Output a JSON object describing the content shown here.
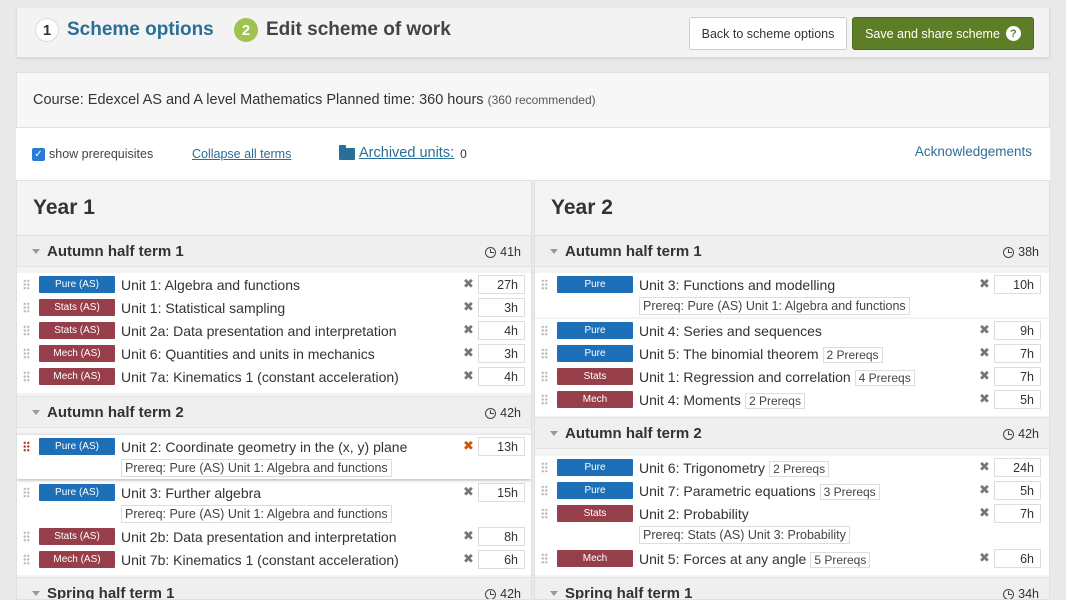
{
  "header": {
    "step1": {
      "num": "1",
      "label": "Scheme options"
    },
    "step2": {
      "num": "2",
      "label": "Edit scheme of work"
    },
    "back_label": "Back to scheme options",
    "save_label": "Save and share scheme",
    "help_glyph": "?"
  },
  "course": {
    "text": "Course: Edexcel AS and A level Mathematics Planned time: 360 hours",
    "recommended": "(360 recommended)"
  },
  "options": {
    "show_prereq": "show prerequisites",
    "collapse_all": "Collapse all terms",
    "archived_label": "Archived units:",
    "archived_count": "0",
    "acknowledgements": "Acknowledgements"
  },
  "colors": {
    "pure": "#1d6fb8",
    "stats": "#963f4a",
    "mech": "#963f4a",
    "save_green": "#5e7d27"
  },
  "years": [
    {
      "title": "Year 1",
      "terms": [
        {
          "name": "Autumn half term 1",
          "hours": "41h",
          "units": [
            {
              "badge": "Pure (AS)",
              "type": "pure",
              "title": "Unit 1: Algebra and functions",
              "hours": "27h"
            },
            {
              "badge": "Stats (AS)",
              "type": "stats",
              "title": "Unit 1: Statistical sampling",
              "hours": "3h"
            },
            {
              "badge": "Stats (AS)",
              "type": "stats",
              "title": "Unit 2a: Data presentation and interpretation",
              "hours": "4h"
            },
            {
              "badge": "Mech (AS)",
              "type": "mech",
              "title": "Unit 6: Quantities and units in mechanics",
              "hours": "3h"
            },
            {
              "badge": "Mech (AS)",
              "type": "mech",
              "title": "Unit 7a: Kinematics 1 (constant acceleration)",
              "hours": "4h"
            }
          ]
        },
        {
          "name": "Autumn half term 2",
          "hours": "42h",
          "units": [
            {
              "badge": "Pure (AS)",
              "type": "pure",
              "title": "Unit 2: Coordinate geometry in the (x, y) plane",
              "prereq": "Prereq: Pure (AS) Unit 1: Algebra and functions",
              "hours": "13h"
            },
            {
              "badge": "Pure (AS)",
              "type": "pure",
              "title": "Unit 3: Further algebra",
              "prereq": "Prereq: Pure (AS) Unit 1: Algebra and functions",
              "hours": "15h"
            },
            {
              "badge": "Stats (AS)",
              "type": "stats",
              "title": "Unit 2b: Data presentation and interpretation",
              "hours": "8h"
            },
            {
              "badge": "Mech (AS)",
              "type": "mech",
              "title": "Unit 7b: Kinematics 1 (constant acceleration)",
              "hours": "6h"
            }
          ]
        },
        {
          "name": "Spring half term 1",
          "hours": "42h"
        }
      ]
    },
    {
      "title": "Year 2",
      "terms": [
        {
          "name": "Autumn half term 1",
          "hours": "38h",
          "units": [
            {
              "badge": "Pure",
              "type": "pure",
              "title": "Unit 3: Functions and modelling",
              "prereq": "Prereq: Pure (AS) Unit 1: Algebra and functions",
              "hours": "10h"
            },
            {
              "badge": "Pure",
              "type": "pure",
              "title": "Unit 4: Series and sequences",
              "hours": "9h"
            },
            {
              "badge": "Pure",
              "type": "pure",
              "title": "Unit 5: The binomial theorem",
              "count": "2 Prereqs",
              "hours": "7h"
            },
            {
              "badge": "Stats",
              "type": "stats",
              "title": "Unit 1: Regression and correlation",
              "count": "4 Prereqs",
              "hours": "7h"
            },
            {
              "badge": "Mech",
              "type": "mech",
              "title": "Unit 4: Moments",
              "count": "2 Prereqs",
              "hours": "5h"
            }
          ]
        },
        {
          "name": "Autumn half term 2",
          "hours": "42h",
          "units": [
            {
              "badge": "Pure",
              "type": "pure",
              "title": "Unit 6: Trigonometry",
              "count": "2 Prereqs",
              "hours": "24h"
            },
            {
              "badge": "Pure",
              "type": "pure",
              "title": "Unit 7: Parametric equations",
              "count": "3 Prereqs",
              "hours": "5h"
            },
            {
              "badge": "Stats",
              "type": "stats",
              "title": "Unit 2: Probability",
              "prereq": "Prereq: Stats (AS) Unit 3: Probability",
              "hours": "7h"
            },
            {
              "badge": "Mech",
              "type": "mech",
              "title": "Unit 5: Forces at any angle",
              "count": "5 Prereqs",
              "hours": "6h"
            }
          ]
        },
        {
          "name": "Spring half term 1",
          "hours": "34h"
        }
      ]
    }
  ]
}
